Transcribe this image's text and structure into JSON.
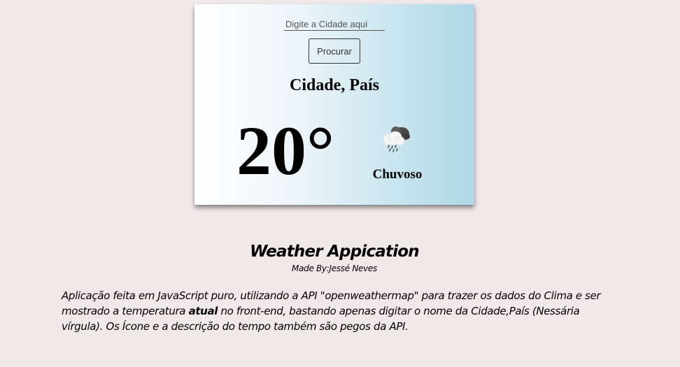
{
  "weather_card": {
    "search": {
      "placeholder": "Digite a Cidade aqui",
      "value": ""
    },
    "search_button_label": "Procurar",
    "location": "Cidade, País",
    "temperature": "20°",
    "weather_icon": "rain-cloud-icon",
    "description": "Chuvoso",
    "colors": {
      "gradient_start": "#ffffff",
      "gradient_end": "#add8e6"
    }
  },
  "info": {
    "title": "Weather Appication",
    "author": "Made By:Jessé Neves",
    "text_before": "Aplicação feita em JavaScript puro, utilizando a API \"openweathermap\" para trazer os dados do Clima e ser mostrado a temperatura ",
    "text_emphasis": "atual",
    "text_after": " no front-end, bastando apenas digitar o nome da Cidade,País (Nessária vírgula). Os Ícone e a descrição do tempo também são pegos da API."
  },
  "page": {
    "background": "#f0e8e9"
  }
}
